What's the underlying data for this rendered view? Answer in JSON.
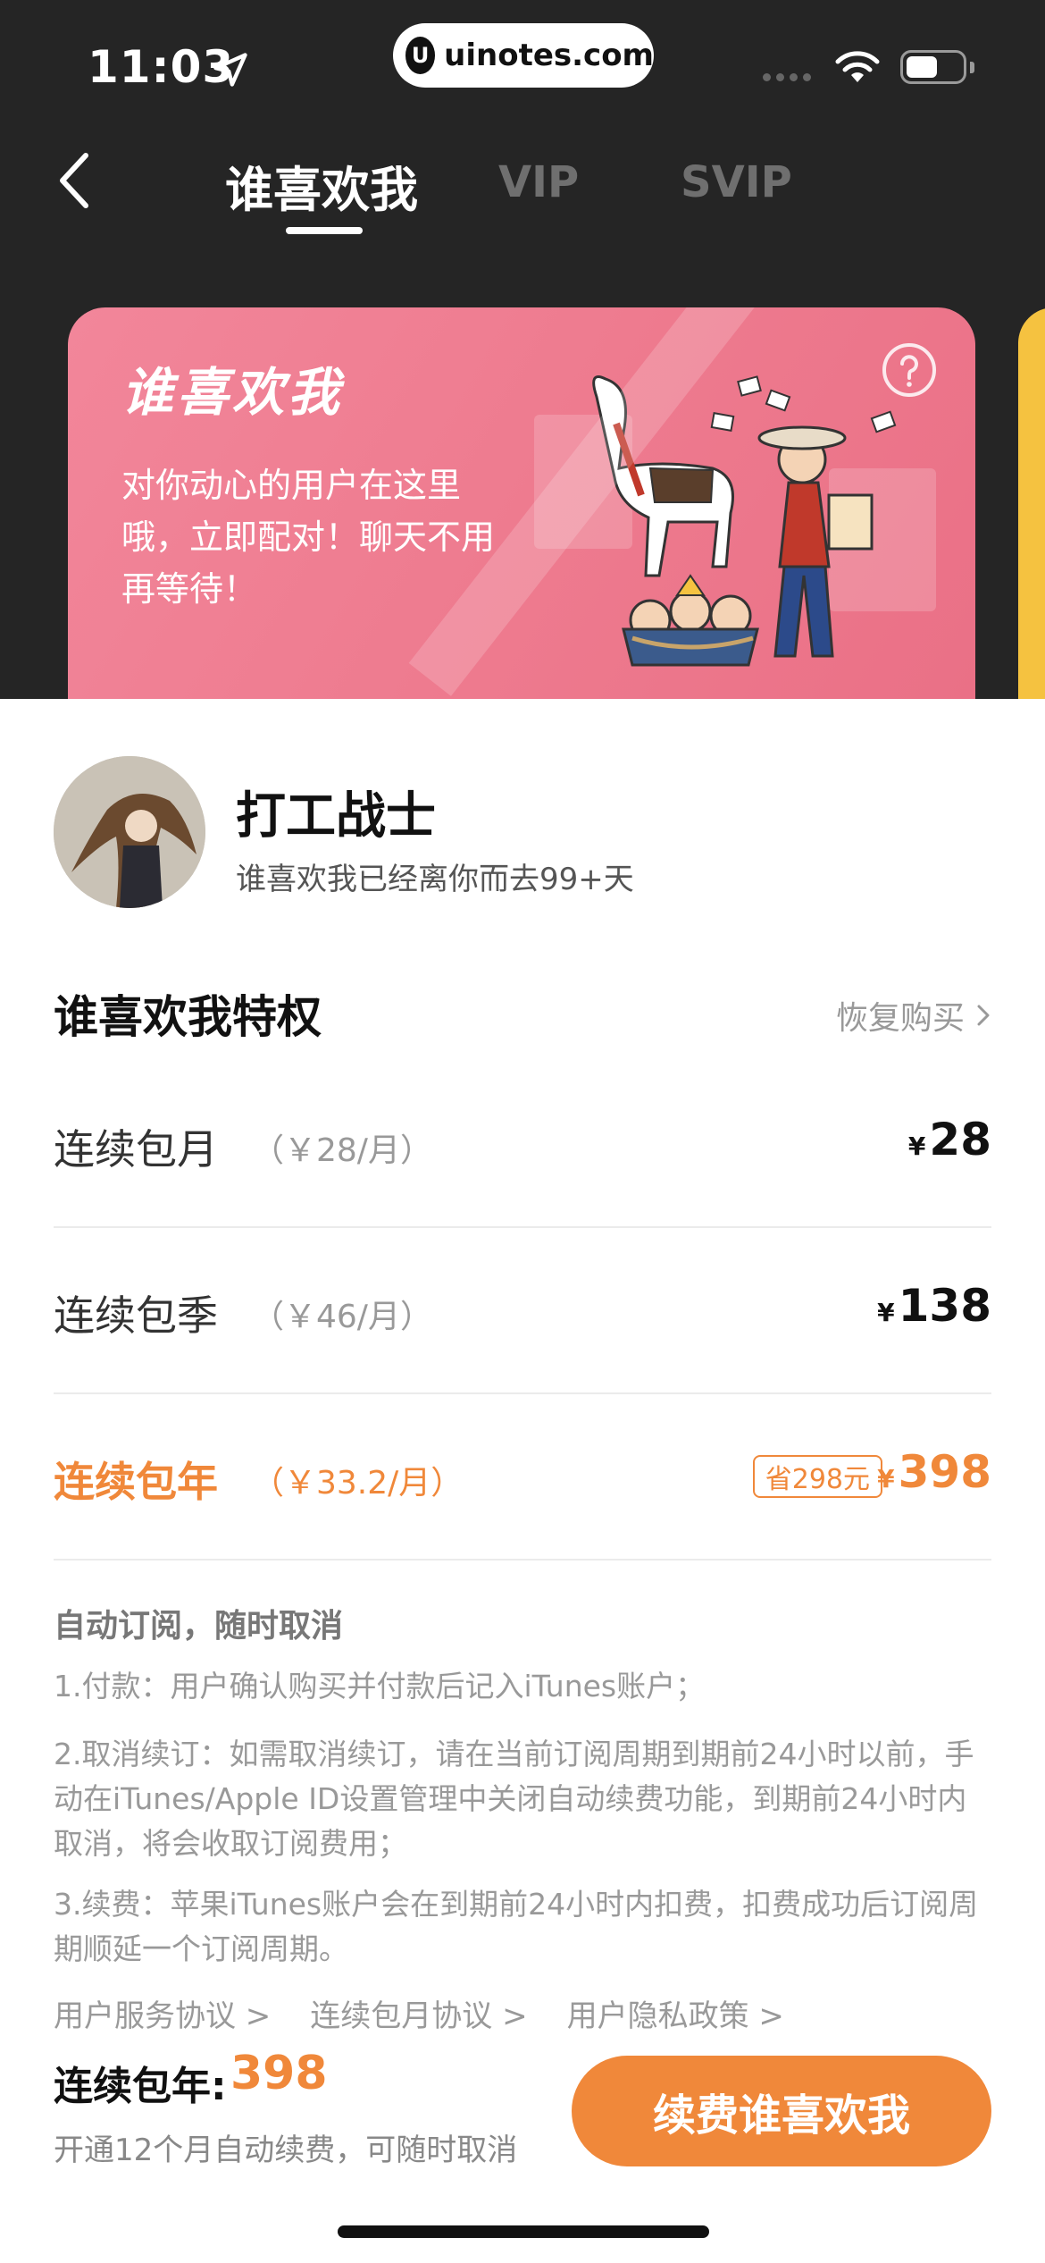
{
  "status_bar": {
    "time": "11:03",
    "watermark": "uinotes.com",
    "watermark_logo": "U"
  },
  "nav": {
    "tabs": [
      {
        "label": "谁喜欢我",
        "active": true
      },
      {
        "label": "VIP",
        "active": false
      },
      {
        "label": "SVIP",
        "active": false
      }
    ]
  },
  "banner": {
    "title": "谁喜欢我",
    "description": "对你动心的用户在这里哦，立即配对！聊天不用再等待！",
    "help_icon": "question-circle-icon"
  },
  "user": {
    "name": "打工战士",
    "subtitle": "谁喜欢我已经离你而去99+天"
  },
  "privileges": {
    "title": "谁喜欢我特权",
    "restore_label": "恢复购买"
  },
  "plans": [
    {
      "name": "连续包月",
      "per_month": "（￥28/月）",
      "currency": "¥",
      "price": "28",
      "badge": "",
      "selected": false
    },
    {
      "name": "连续包季",
      "per_month": "（￥46/月）",
      "currency": "¥",
      "price": "138",
      "badge": "",
      "selected": false
    },
    {
      "name": "连续包年",
      "per_month": "（￥33.2/月）",
      "currency": "¥",
      "price": "398",
      "badge": "省298元",
      "selected": true
    }
  ],
  "notice": {
    "title": "自动订阅，随时取消",
    "items": [
      "1.付款：用户确认购买并付款后记入iTunes账户；",
      "2.取消续订：如需取消续订，请在当前订阅周期到期前24小时以前，手动在iTunes/Apple ID设置管理中关闭自动续费功能，到期前24小时内取消，将会收取订阅费用；",
      "3.续费：苹果iTunes账户会在到期前24小时内扣费，扣费成功后订阅周期顺延一个订阅周期。"
    ]
  },
  "links": [
    "用户服务协议 >",
    "连续包月协议 >",
    "用户隐私政策 >"
  ],
  "footer": {
    "label": "连续包年:",
    "price": "398",
    "subtitle": "开通12个月自动续费，可随时取消",
    "cta": "续费谁喜欢我"
  },
  "colors": {
    "accent": "#f0883a",
    "header_bg": "#252525",
    "banner_pink": "#ee7b8f",
    "next_card_yellow": "#f5c240"
  }
}
